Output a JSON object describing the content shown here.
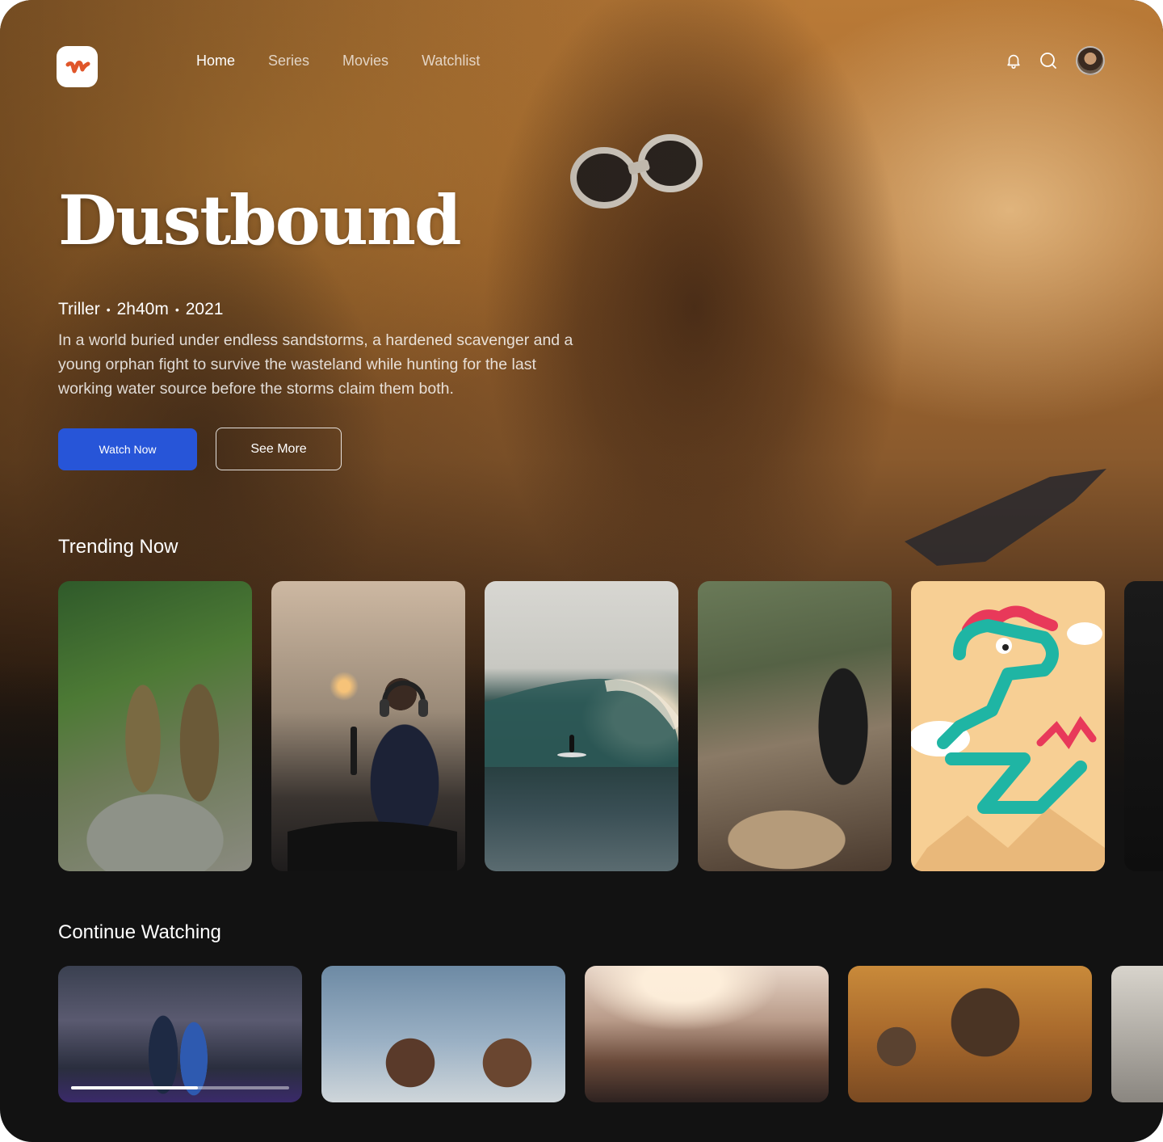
{
  "nav": {
    "items": [
      "Home",
      "Series",
      "Movies",
      "Watchlist"
    ],
    "active": "Home"
  },
  "header_icons": [
    "bell-icon",
    "search-icon"
  ],
  "hero": {
    "title": "Dustbound",
    "genre": "Triller",
    "duration": "2h40m",
    "year": "2021",
    "separator": "•",
    "description": "In a world buried under endless sandstorms, a hardened scavenger and a young orphan fight to survive the wasteland while hunting for the last working water source before the storms claim them both.",
    "watch_now_label": "Watch Now",
    "see_more_label": "See More"
  },
  "trending": {
    "title": "Trending Now",
    "count_visible": 6
  },
  "continue_watching": {
    "title": "Continue Watching",
    "first_item_progress": 0.58
  },
  "colors": {
    "accent": "#2755d8",
    "background": "#121212"
  }
}
